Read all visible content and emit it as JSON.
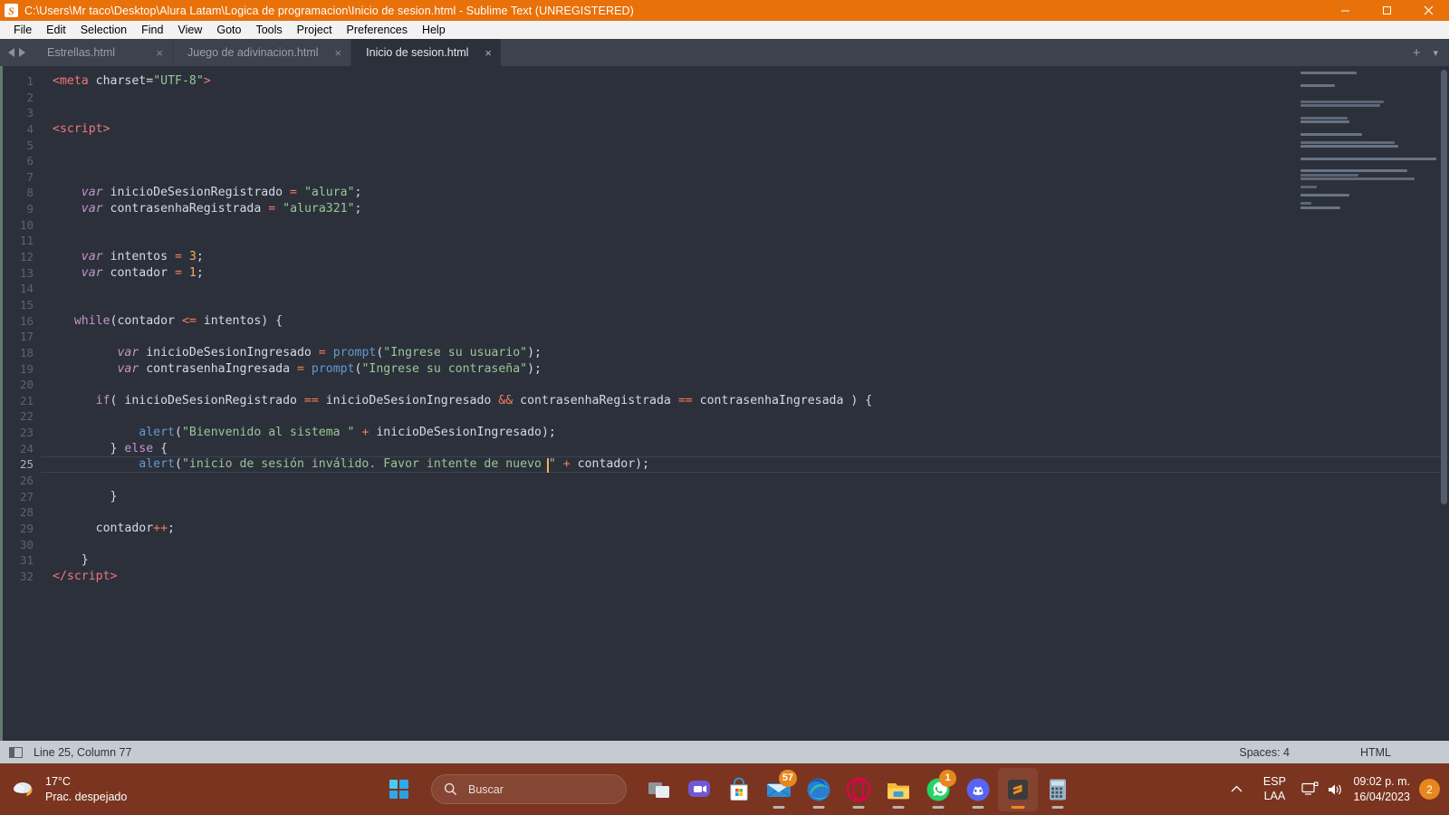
{
  "titlebar": {
    "title": "C:\\Users\\Mr taco\\Desktop\\Alura Latam\\Logica de programacion\\Inicio de sesion.html - Sublime Text (UNREGISTERED)",
    "logo_letter": "S",
    "minimize": "minimize-icon",
    "maximize": "maximize-icon",
    "close": "close-icon"
  },
  "menubar": {
    "items": [
      {
        "label": "File"
      },
      {
        "label": "Edit"
      },
      {
        "label": "Selection"
      },
      {
        "label": "Find"
      },
      {
        "label": "View"
      },
      {
        "label": "Goto"
      },
      {
        "label": "Tools"
      },
      {
        "label": "Project"
      },
      {
        "label": "Preferences"
      },
      {
        "label": "Help"
      }
    ]
  },
  "tabs": {
    "items": [
      {
        "label": "Estrellas.html",
        "active": false,
        "close": "×"
      },
      {
        "label": "Juego de adivinacion.html",
        "active": false,
        "close": "×"
      },
      {
        "label": "Inicio de sesion.html",
        "active": true,
        "close": "×"
      }
    ],
    "new_tab": "+",
    "tab_menu": "▾"
  },
  "editor": {
    "first_line": 1,
    "last_line": 32,
    "current_line": 25,
    "lines": [
      {
        "n": 1,
        "tokens": [
          {
            "t": "<",
            "c": "tag"
          },
          {
            "t": "meta",
            "c": "tag"
          },
          {
            "t": " charset=",
            "c": "plain"
          },
          {
            "t": "\"UTF-8\"",
            "c": "str"
          },
          {
            "t": ">",
            "c": "tag"
          }
        ]
      },
      {
        "n": 2,
        "tokens": []
      },
      {
        "n": 3,
        "tokens": []
      },
      {
        "n": 4,
        "tokens": [
          {
            "t": "<",
            "c": "tag"
          },
          {
            "t": "script",
            "c": "tag"
          },
          {
            "t": ">",
            "c": "tag"
          }
        ]
      },
      {
        "n": 5,
        "tokens": []
      },
      {
        "n": 6,
        "tokens": []
      },
      {
        "n": 7,
        "tokens": []
      },
      {
        "n": 8,
        "tokens": [
          {
            "t": "    ",
            "c": "plain"
          },
          {
            "t": "var",
            "c": "kw2"
          },
          {
            "t": " inicioDeSesionRegistrado ",
            "c": "plain"
          },
          {
            "t": "=",
            "c": "op"
          },
          {
            "t": " ",
            "c": "plain"
          },
          {
            "t": "\"alura\"",
            "c": "str"
          },
          {
            "t": ";",
            "c": "plain"
          }
        ]
      },
      {
        "n": 9,
        "tokens": [
          {
            "t": "    ",
            "c": "plain"
          },
          {
            "t": "var",
            "c": "kw2"
          },
          {
            "t": " contrasenhaRegistrada ",
            "c": "plain"
          },
          {
            "t": "=",
            "c": "op"
          },
          {
            "t": " ",
            "c": "plain"
          },
          {
            "t": "\"alura321\"",
            "c": "str"
          },
          {
            "t": ";",
            "c": "plain"
          }
        ]
      },
      {
        "n": 10,
        "tokens": []
      },
      {
        "n": 11,
        "tokens": []
      },
      {
        "n": 12,
        "tokens": [
          {
            "t": "    ",
            "c": "plain"
          },
          {
            "t": "var",
            "c": "kw2"
          },
          {
            "t": " intentos ",
            "c": "plain"
          },
          {
            "t": "=",
            "c": "op"
          },
          {
            "t": " ",
            "c": "plain"
          },
          {
            "t": "3",
            "c": "num"
          },
          {
            "t": ";",
            "c": "plain"
          }
        ]
      },
      {
        "n": 13,
        "tokens": [
          {
            "t": "    ",
            "c": "plain"
          },
          {
            "t": "var",
            "c": "kw2"
          },
          {
            "t": " contador ",
            "c": "plain"
          },
          {
            "t": "=",
            "c": "op"
          },
          {
            "t": " ",
            "c": "plain"
          },
          {
            "t": "1",
            "c": "num"
          },
          {
            "t": ";",
            "c": "plain"
          }
        ]
      },
      {
        "n": 14,
        "tokens": []
      },
      {
        "n": 15,
        "tokens": []
      },
      {
        "n": 16,
        "tokens": [
          {
            "t": "   ",
            "c": "plain"
          },
          {
            "t": "while",
            "c": "kw"
          },
          {
            "t": "(contador ",
            "c": "plain"
          },
          {
            "t": "<=",
            "c": "op"
          },
          {
            "t": " intentos) {",
            "c": "plain"
          }
        ]
      },
      {
        "n": 17,
        "tokens": []
      },
      {
        "n": 18,
        "tokens": [
          {
            "t": "         ",
            "c": "plain"
          },
          {
            "t": "var",
            "c": "kw2"
          },
          {
            "t": " inicioDeSesionIngresado ",
            "c": "plain"
          },
          {
            "t": "=",
            "c": "op"
          },
          {
            "t": " ",
            "c": "plain"
          },
          {
            "t": "prompt",
            "c": "fn"
          },
          {
            "t": "(",
            "c": "plain"
          },
          {
            "t": "\"Ingrese su usuario\"",
            "c": "str"
          },
          {
            "t": ");",
            "c": "plain"
          }
        ]
      },
      {
        "n": 19,
        "tokens": [
          {
            "t": "         ",
            "c": "plain"
          },
          {
            "t": "var",
            "c": "kw2"
          },
          {
            "t": " contrasenhaIngresada ",
            "c": "plain"
          },
          {
            "t": "=",
            "c": "op"
          },
          {
            "t": " ",
            "c": "plain"
          },
          {
            "t": "prompt",
            "c": "fn"
          },
          {
            "t": "(",
            "c": "plain"
          },
          {
            "t": "\"Ingrese su contraseña\"",
            "c": "str"
          },
          {
            "t": ");",
            "c": "plain"
          }
        ]
      },
      {
        "n": 20,
        "tokens": []
      },
      {
        "n": 21,
        "tokens": [
          {
            "t": "      ",
            "c": "plain"
          },
          {
            "t": "if",
            "c": "kw"
          },
          {
            "t": "( inicioDeSesionRegistrado ",
            "c": "plain"
          },
          {
            "t": "==",
            "c": "op"
          },
          {
            "t": " inicioDeSesionIngresado ",
            "c": "plain"
          },
          {
            "t": "&&",
            "c": "op"
          },
          {
            "t": " contrasenhaRegistrada ",
            "c": "plain"
          },
          {
            "t": "==",
            "c": "op"
          },
          {
            "t": " contrasenhaIngresada ) {",
            "c": "plain"
          }
        ]
      },
      {
        "n": 22,
        "tokens": []
      },
      {
        "n": 23,
        "tokens": [
          {
            "t": "            ",
            "c": "plain"
          },
          {
            "t": "alert",
            "c": "fn"
          },
          {
            "t": "(",
            "c": "plain"
          },
          {
            "t": "\"Bienvenido al sistema \"",
            "c": "str"
          },
          {
            "t": " ",
            "c": "plain"
          },
          {
            "t": "+",
            "c": "op"
          },
          {
            "t": " inicioDeSesionIngresado);",
            "c": "plain"
          }
        ]
      },
      {
        "n": 24,
        "tokens": [
          {
            "t": "        } ",
            "c": "plain"
          },
          {
            "t": "else",
            "c": "kw"
          },
          {
            "t": " {",
            "c": "plain"
          }
        ]
      },
      {
        "n": 25,
        "tokens": [
          {
            "t": "            ",
            "c": "plain"
          },
          {
            "t": "alert",
            "c": "fn"
          },
          {
            "t": "(",
            "c": "plain"
          },
          {
            "t": "\"inicio de sesión inválido. Favor intente de nuevo \"",
            "c": "str"
          },
          {
            "t": " ",
            "c": "plain"
          },
          {
            "t": "+",
            "c": "op"
          },
          {
            "t": " contador);",
            "c": "plain"
          }
        ]
      },
      {
        "n": 26,
        "tokens": []
      },
      {
        "n": 27,
        "tokens": [
          {
            "t": "        }",
            "c": "plain"
          }
        ]
      },
      {
        "n": 28,
        "tokens": []
      },
      {
        "n": 29,
        "tokens": [
          {
            "t": "      contador",
            "c": "plain"
          },
          {
            "t": "++",
            "c": "op"
          },
          {
            "t": ";",
            "c": "plain"
          }
        ]
      },
      {
        "n": 30,
        "tokens": []
      },
      {
        "n": 31,
        "tokens": [
          {
            "t": "    }",
            "c": "plain"
          }
        ]
      },
      {
        "n": 32,
        "tokens": [
          {
            "t": "</",
            "c": "tag"
          },
          {
            "t": "script",
            "c": "tag"
          },
          {
            "t": ">",
            "c": "tag"
          }
        ]
      }
    ]
  },
  "statusbar": {
    "sidebar_toggle": "sidebar-toggle-icon",
    "position": "Line 25, Column 77",
    "indentation": "Spaces: 4",
    "syntax": "HTML"
  },
  "taskbar": {
    "weather": {
      "temperature": "17°C",
      "description": "Prac. despejado",
      "icon": "moon-cloud-icon"
    },
    "start": "windows-start-icon",
    "search": {
      "placeholder": "Buscar",
      "icon": "search-icon"
    },
    "apps": [
      {
        "name": "task-view-icon",
        "badge": null,
        "running": false,
        "active": false
      },
      {
        "name": "chat-icon",
        "badge": null,
        "running": false,
        "active": false
      },
      {
        "name": "microsoft-store-icon",
        "badge": null,
        "running": false,
        "active": false
      },
      {
        "name": "mail-icon",
        "badge": "57",
        "running": true,
        "active": false
      },
      {
        "name": "microsoft-edge-icon",
        "badge": null,
        "running": true,
        "active": false
      },
      {
        "name": "opera-icon",
        "badge": null,
        "running": true,
        "active": false
      },
      {
        "name": "file-explorer-icon",
        "badge": null,
        "running": true,
        "active": false
      },
      {
        "name": "whatsapp-icon",
        "badge": "1",
        "running": true,
        "active": false
      },
      {
        "name": "discord-icon",
        "badge": null,
        "running": true,
        "active": false
      },
      {
        "name": "sublime-text-icon",
        "badge": null,
        "running": true,
        "active": true
      },
      {
        "name": "calculator-icon",
        "badge": null,
        "running": true,
        "active": false
      }
    ],
    "tray": {
      "chevron": "show-hidden-icons-chevron",
      "language_line1": "ESP",
      "language_line2": "LAA",
      "network_icon": "network-icon",
      "volume_icon": "volume-icon",
      "time": "09:02 p. m.",
      "date": "16/04/2023",
      "notification_count": "2"
    }
  },
  "colors": {
    "titlebar": "#e8710a",
    "editor_bg": "#2b303b",
    "tabbar_bg": "#3c424e",
    "statusbar_bg": "#c6cad2",
    "taskbar_bg": "#7a3420",
    "accent_orange": "#f2871e"
  }
}
